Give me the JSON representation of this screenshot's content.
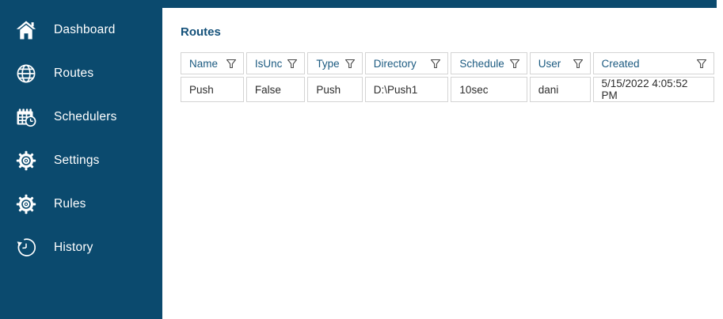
{
  "colors": {
    "sidebar_bg": "#0b4a6e",
    "title_text": "#14517a",
    "header_text": "#1b5a80",
    "cell_text": "#2e2e2e",
    "grid_border": "#d4d4d4",
    "funnel_icon": "#4a4a4a",
    "sidebar_text": "#ffffff"
  },
  "sidebar": {
    "items": [
      {
        "label": "Dashboard",
        "icon": "home-icon"
      },
      {
        "label": "Routes",
        "icon": "globe-icon"
      },
      {
        "label": "Schedulers",
        "icon": "calendar-clock-icon"
      },
      {
        "label": "Settings",
        "icon": "gear-icon"
      },
      {
        "label": "Rules",
        "icon": "gear-icon"
      },
      {
        "label": "History",
        "icon": "history-icon"
      }
    ]
  },
  "main": {
    "title": "Routes",
    "table": {
      "columns": [
        {
          "label": "Name"
        },
        {
          "label": "IsUnc"
        },
        {
          "label": "Type"
        },
        {
          "label": "Directory"
        },
        {
          "label": "Schedule"
        },
        {
          "label": "User"
        },
        {
          "label": "Created"
        }
      ],
      "rows": [
        [
          "Push",
          "False",
          "Push",
          "D:\\Push1",
          "10sec",
          "dani",
          "5/15/2022 4:05:52 PM"
        ]
      ]
    }
  }
}
